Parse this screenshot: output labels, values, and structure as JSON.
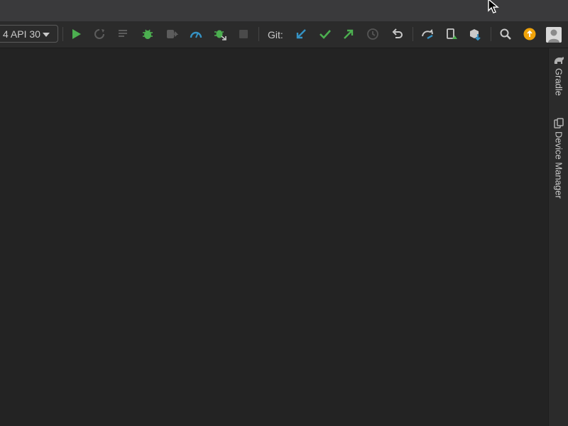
{
  "toolbar": {
    "device_label": "4 API 30",
    "git_label": "Git:"
  },
  "right_panel": {
    "tabs": [
      {
        "label": "Gradle",
        "icon": "gradle-elephant-icon"
      },
      {
        "label": "Device Manager",
        "icon": "device-manager-icon"
      }
    ]
  },
  "colors": {
    "run_green": "#4caf50",
    "git_blue": "#3592c4",
    "update_orange": "#f0a30a",
    "editor_bg": "#232323"
  }
}
